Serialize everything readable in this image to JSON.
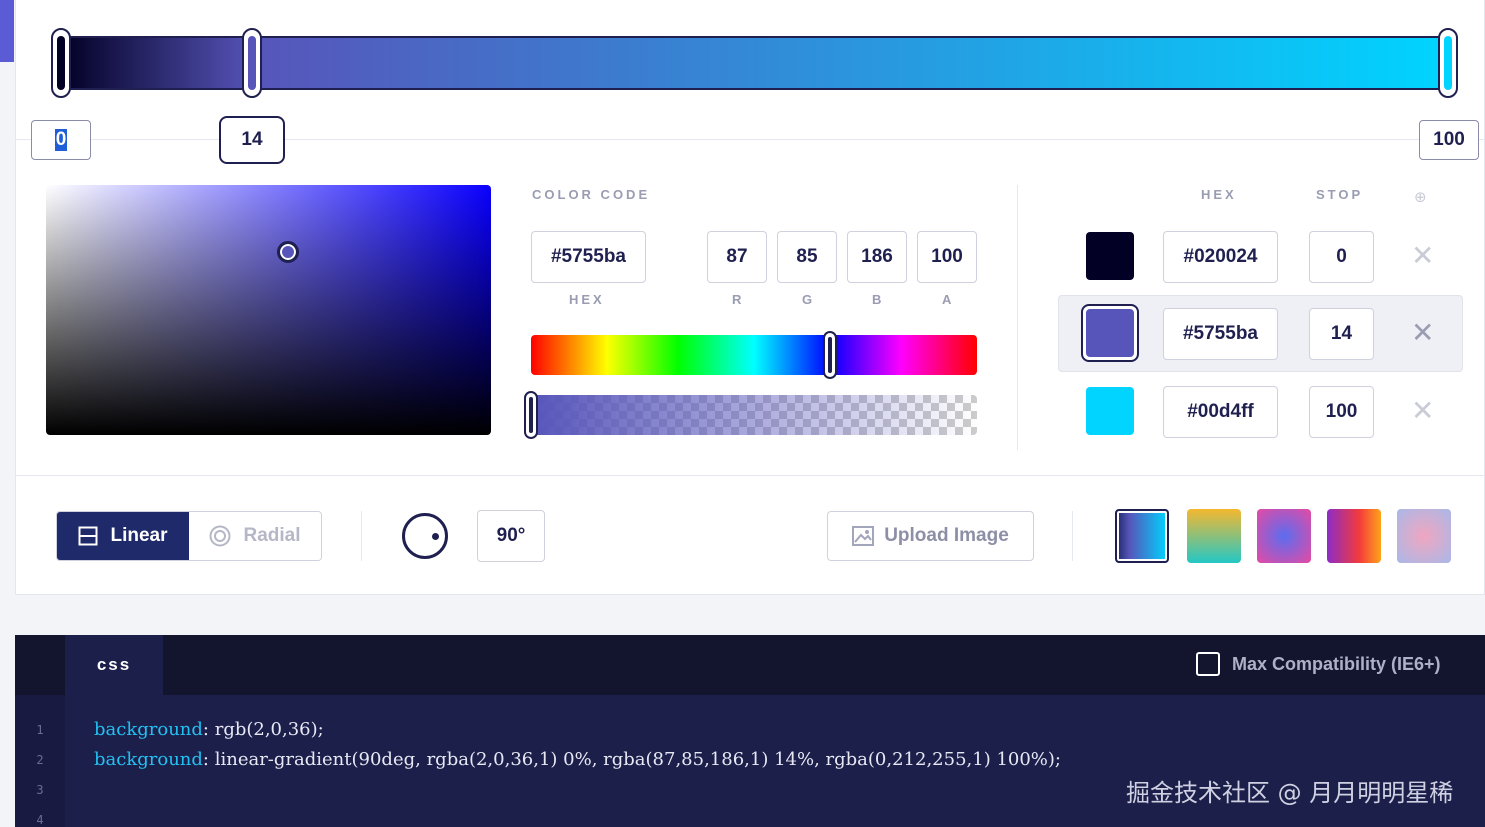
{
  "gradient": {
    "stops": [
      {
        "position": 0,
        "hex": "#020024",
        "r": 2,
        "g": 0,
        "b": 36,
        "a": 1
      },
      {
        "position": 14,
        "hex": "#5755ba",
        "r": 87,
        "g": 85,
        "b": 186,
        "a": 1
      },
      {
        "position": 100,
        "hex": "#00d4ff",
        "r": 0,
        "g": 212,
        "b": 255,
        "a": 1
      }
    ],
    "stop_inputs": {
      "first": "0",
      "second": "14",
      "third": "100"
    },
    "active_stop_index": 1
  },
  "picker": {
    "color_code_label": "COLOR CODE",
    "hex_value": "#5755ba",
    "r": "87",
    "g": "85",
    "b": "186",
    "a": "100",
    "labels": {
      "hex": "HEX",
      "r": "R",
      "g": "G",
      "b": "B",
      "a": "A"
    },
    "hue_fraction": 0.67,
    "alpha_fraction": 1.0
  },
  "stops_table": {
    "headers": {
      "hex": "HEX",
      "stop": "STOP",
      "add": "⊕"
    },
    "rows": [
      {
        "swatch": "#020024",
        "hex": "#020024",
        "stop": "0",
        "remove": "✕"
      },
      {
        "swatch": "#5755ba",
        "hex": "#5755ba",
        "stop": "14",
        "remove": "✕"
      },
      {
        "swatch": "#00d4ff",
        "hex": "#00d4ff",
        "stop": "100",
        "remove": "✕"
      }
    ]
  },
  "toolbar": {
    "linear_label": "Linear",
    "radial_label": "Radial",
    "angle_value": "90°",
    "upload_label": "Upload Image",
    "presets": [
      "linear-gradient(90deg,#1f2a6a,#5755ba 25%,#00d4ff)",
      "linear-gradient(180deg,#f5b82f,#23c7c6)",
      "radial-gradient(circle,#5b6df0,#e64aa3)",
      "linear-gradient(90deg,#8c2cc7,#f33b3b 60%,#ffa31a)",
      "radial-gradient(circle,#f0a6c0,#a9b8e8)"
    ]
  },
  "code": {
    "tab_label": "css",
    "compat_label": "Max Compatibility (IE6+)",
    "line_numbers": [
      "1",
      "2",
      "3",
      "4"
    ],
    "line1_prop": "background",
    "line1_value": ": rgb(2,0,36);",
    "line2_prop": "background",
    "line2_value": ": linear-gradient(90deg, rgba(2,0,36,1) 0%, rgba(87,85,186,1) 14%, rgba(0,212,255,1) 100%);"
  },
  "watermark": "掘金技术社区 @ 月月明明星稀",
  "colors": {
    "accent": "#1f2a6a",
    "brand": "#5755ba",
    "cyan": "#00d4ff"
  }
}
